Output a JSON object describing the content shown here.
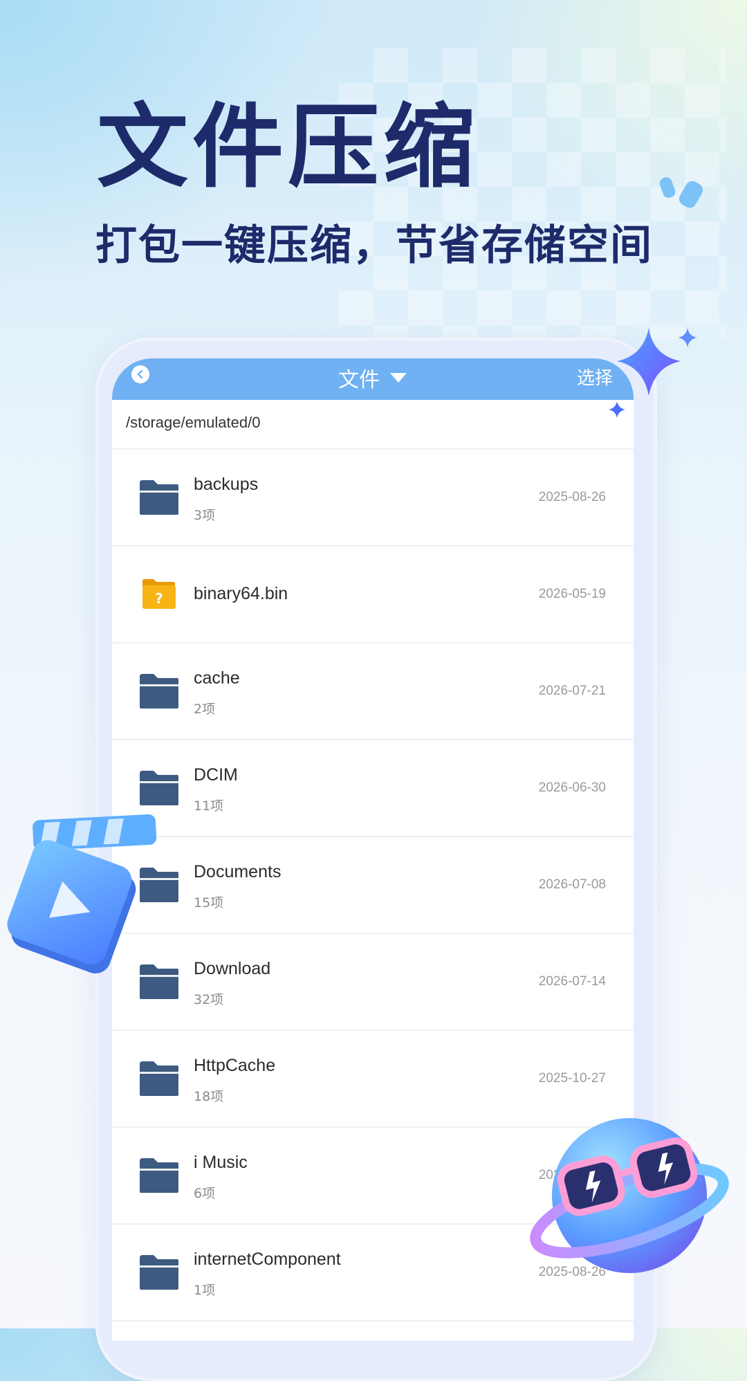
{
  "promo": {
    "headline": "文件压缩",
    "subline": "打包一键压缩，节省存储空间"
  },
  "app": {
    "title": "文件",
    "select_label": "选择",
    "path": "/storage/emulated/0",
    "accent": "#6fb1f2",
    "folder_color": "#3d5a80"
  },
  "files": [
    {
      "name": "backups",
      "count": "3项",
      "date": "2025-08-26",
      "icon": "folder-icon"
    },
    {
      "name": "binary64.bin",
      "count": "",
      "date": "2026-05-19",
      "icon": "unknown-file-icon"
    },
    {
      "name": "cache",
      "count": "2项",
      "date": "2026-07-21",
      "icon": "folder-icon"
    },
    {
      "name": "DCIM",
      "count": "11项",
      "date": "2026-06-30",
      "icon": "folder-icon"
    },
    {
      "name": "Documents",
      "count": "15项",
      "date": "2026-07-08",
      "icon": "folder-icon"
    },
    {
      "name": "Download",
      "count": "32项",
      "date": "2026-07-14",
      "icon": "folder-icon"
    },
    {
      "name": "HttpCache",
      "count": "18项",
      "date": "2025-10-27",
      "icon": "folder-icon"
    },
    {
      "name": "i Music",
      "count": "6项",
      "date": "2025-08-26",
      "icon": "folder-icon"
    },
    {
      "name": "internetComponent",
      "count": "1项",
      "date": "2025-08-26",
      "icon": "folder-icon"
    }
  ]
}
